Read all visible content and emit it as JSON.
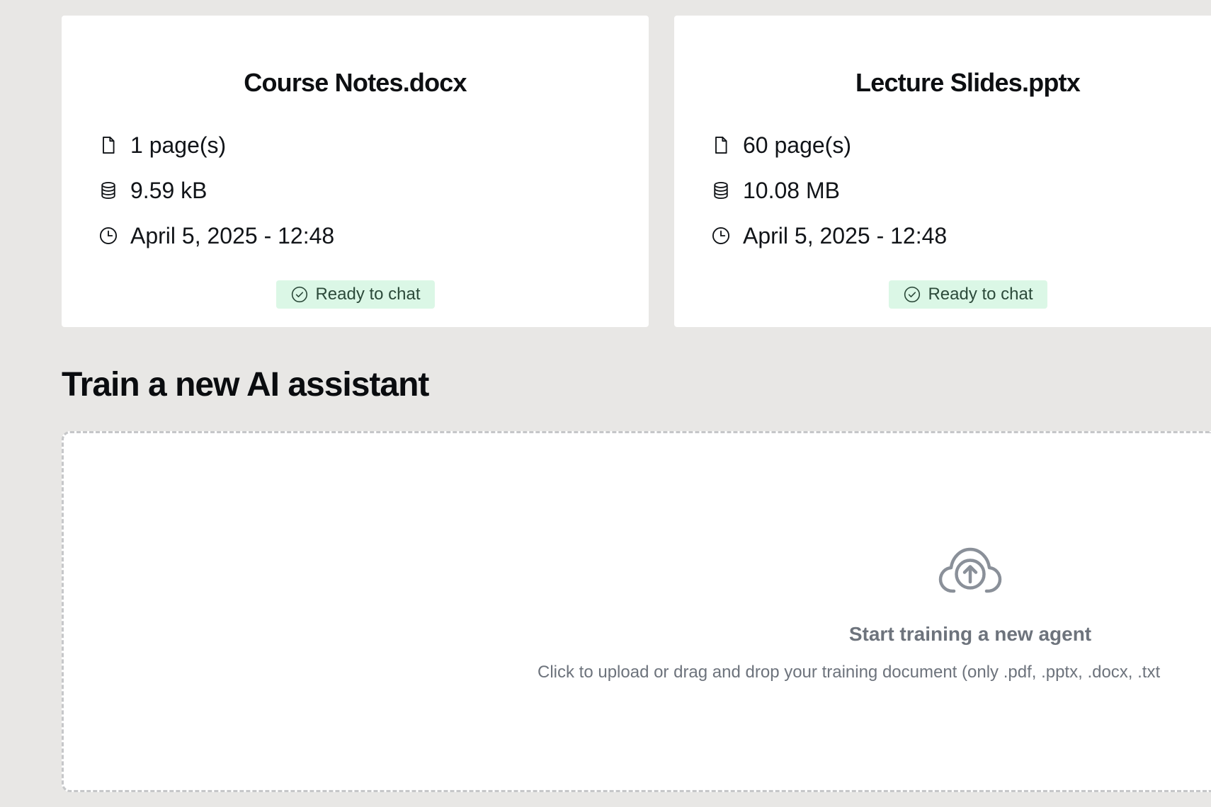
{
  "cards": [
    {
      "title": "Course Notes.docx",
      "pages": "1 page(s)",
      "size": "9.59 kB",
      "date": "April 5, 2025 - 12:48",
      "status": "Ready to chat"
    },
    {
      "title": "Lecture Slides.pptx",
      "pages": "60 page(s)",
      "size": "10.08 MB",
      "date": "April 5, 2025 - 12:48",
      "status": "Ready to chat"
    }
  ],
  "section": {
    "title": "Train a new AI assistant"
  },
  "dropzone": {
    "icon": "cloud-upload-icon",
    "title": "Start training a new agent",
    "subtitle": "Click to upload or drag and drop your training document (only .pdf, .pptx, .docx, .txt"
  },
  "colors": {
    "background": "#e8e7e5",
    "card": "#ffffff",
    "badge_bg": "#dbf7e6",
    "badge_text": "#2c4a3a",
    "muted_text": "#6d737c"
  },
  "icons": {
    "pages": "file-icon",
    "size": "database-icon",
    "date": "clock-icon",
    "status": "check-circle-icon"
  }
}
